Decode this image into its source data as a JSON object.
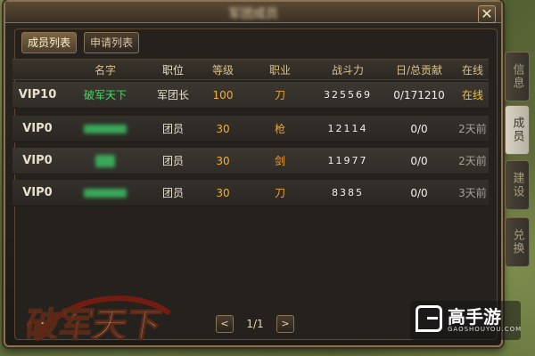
{
  "window": {
    "title": "军团成员"
  },
  "tabs": [
    {
      "label": "成员列表",
      "active": true
    },
    {
      "label": "申请列表",
      "active": false
    }
  ],
  "table": {
    "headers": [
      "名字",
      "职位",
      "等级",
      "职业",
      "战斗力",
      "日/总贡献",
      "在线"
    ],
    "rows": [
      {
        "vip": "VIP10",
        "name": "破军天下",
        "position": "军团长",
        "level": "100",
        "job": "刀",
        "power": "325569",
        "contribution": "0/171210",
        "online": "在线"
      },
      {
        "vip": "VIP0",
        "name": "",
        "position": "团员",
        "level": "30",
        "job": "枪",
        "power": "12114",
        "contribution": "0/0",
        "online": "2天前"
      },
      {
        "vip": "VIP0",
        "name": "",
        "position": "团员",
        "level": "30",
        "job": "剑",
        "power": "11977",
        "contribution": "0/0",
        "online": "2天前"
      },
      {
        "vip": "VIP0",
        "name": "",
        "position": "团员",
        "level": "30",
        "job": "刀",
        "power": "8385",
        "contribution": "0/0",
        "online": "3天前"
      }
    ]
  },
  "pager": {
    "prev": "<",
    "text": "1/1",
    "next": ">"
  },
  "side_tabs": [
    {
      "label": "信息",
      "active": false
    },
    {
      "label": "成员",
      "active": true
    },
    {
      "label": "建设",
      "active": false
    },
    {
      "label": "兑换",
      "active": false
    }
  ],
  "close_icon": "close-icon",
  "logos": {
    "game_logo": "破军天下",
    "site_logo_zh": "高手游",
    "site_logo_en": "GAOSHOUYOU.COM"
  },
  "colors": {
    "accent_gold": "#f0b040",
    "online_green": "#3ce060",
    "panel_border": "#8a7350"
  }
}
